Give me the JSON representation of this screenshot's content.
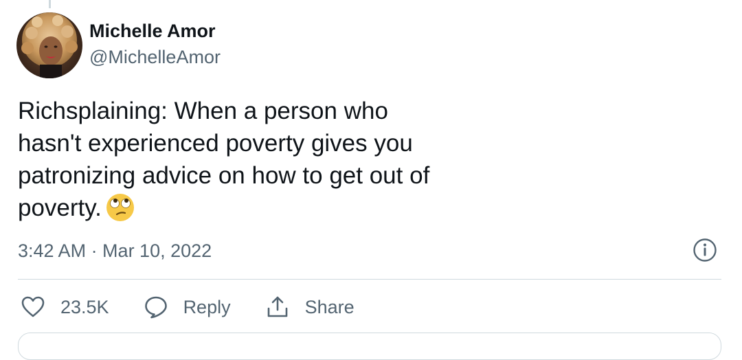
{
  "tweet": {
    "author": {
      "name": "Michelle Amor",
      "handle": "@MichelleAmor"
    },
    "text": "Richsplaining: When a person who hasn't experienced poverty gives you patronizing advice on how to get out of poverty.",
    "emoji": "face-with-rolling-eyes",
    "timestamp": "3:42 AM · Mar 10, 2022"
  },
  "actions": {
    "like": {
      "icon": "heart-icon",
      "label": "23.5K"
    },
    "reply": {
      "icon": "speech-bubble-icon",
      "label": "Reply"
    },
    "share": {
      "icon": "share-icon",
      "label": "Share"
    }
  },
  "colors": {
    "primary_text": "#0f1419",
    "secondary_text": "#536471",
    "divider": "#cfd9de"
  }
}
